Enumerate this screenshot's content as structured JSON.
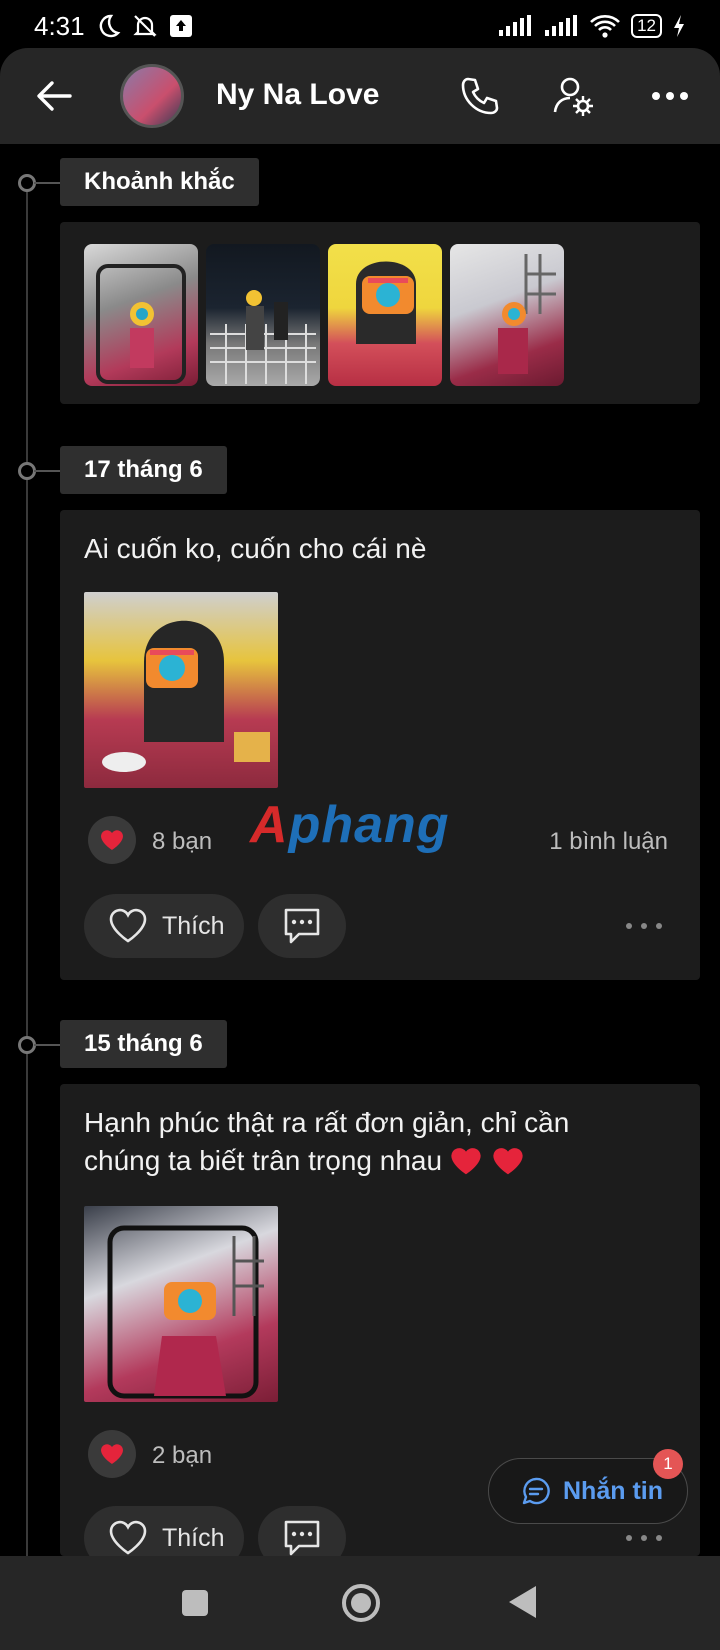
{
  "status_bar": {
    "time": "4:31",
    "battery": "12"
  },
  "header": {
    "title": "Ny Na Love"
  },
  "moments": {
    "label": "Khoảnh khắc"
  },
  "posts": [
    {
      "date": "17 tháng 6",
      "text": "Ai cuốn ko, cuốn cho cái nè",
      "reactions": "8 bạn",
      "comments": "1 bình luận",
      "like_label": "Thích"
    },
    {
      "date": "15 tháng 6",
      "text_line1": "Hạnh phúc thật ra rất đơn giản, chỉ cần",
      "text_line2": "chúng ta biết trân trọng nhau",
      "reactions": "2 bạn",
      "like_label": "Thích"
    }
  ],
  "watermark": {
    "part1": "A",
    "part2": "phang"
  },
  "chat_fab": {
    "label": "Nhắn tin",
    "badge": "1"
  },
  "colors": {
    "background": "#000000",
    "header": "#262626",
    "card": "#1c1c1c",
    "accent_blue": "#5b9cf0",
    "heart_red": "#e5243b",
    "badge_red": "#e45555"
  },
  "icons": [
    "back-arrow-icon",
    "phone-icon",
    "profile-settings-icon",
    "more-icon",
    "heart-icon",
    "comment-icon",
    "chat-icon",
    "moon-icon",
    "mute-icon",
    "wifi-icon",
    "signal-icon"
  ]
}
